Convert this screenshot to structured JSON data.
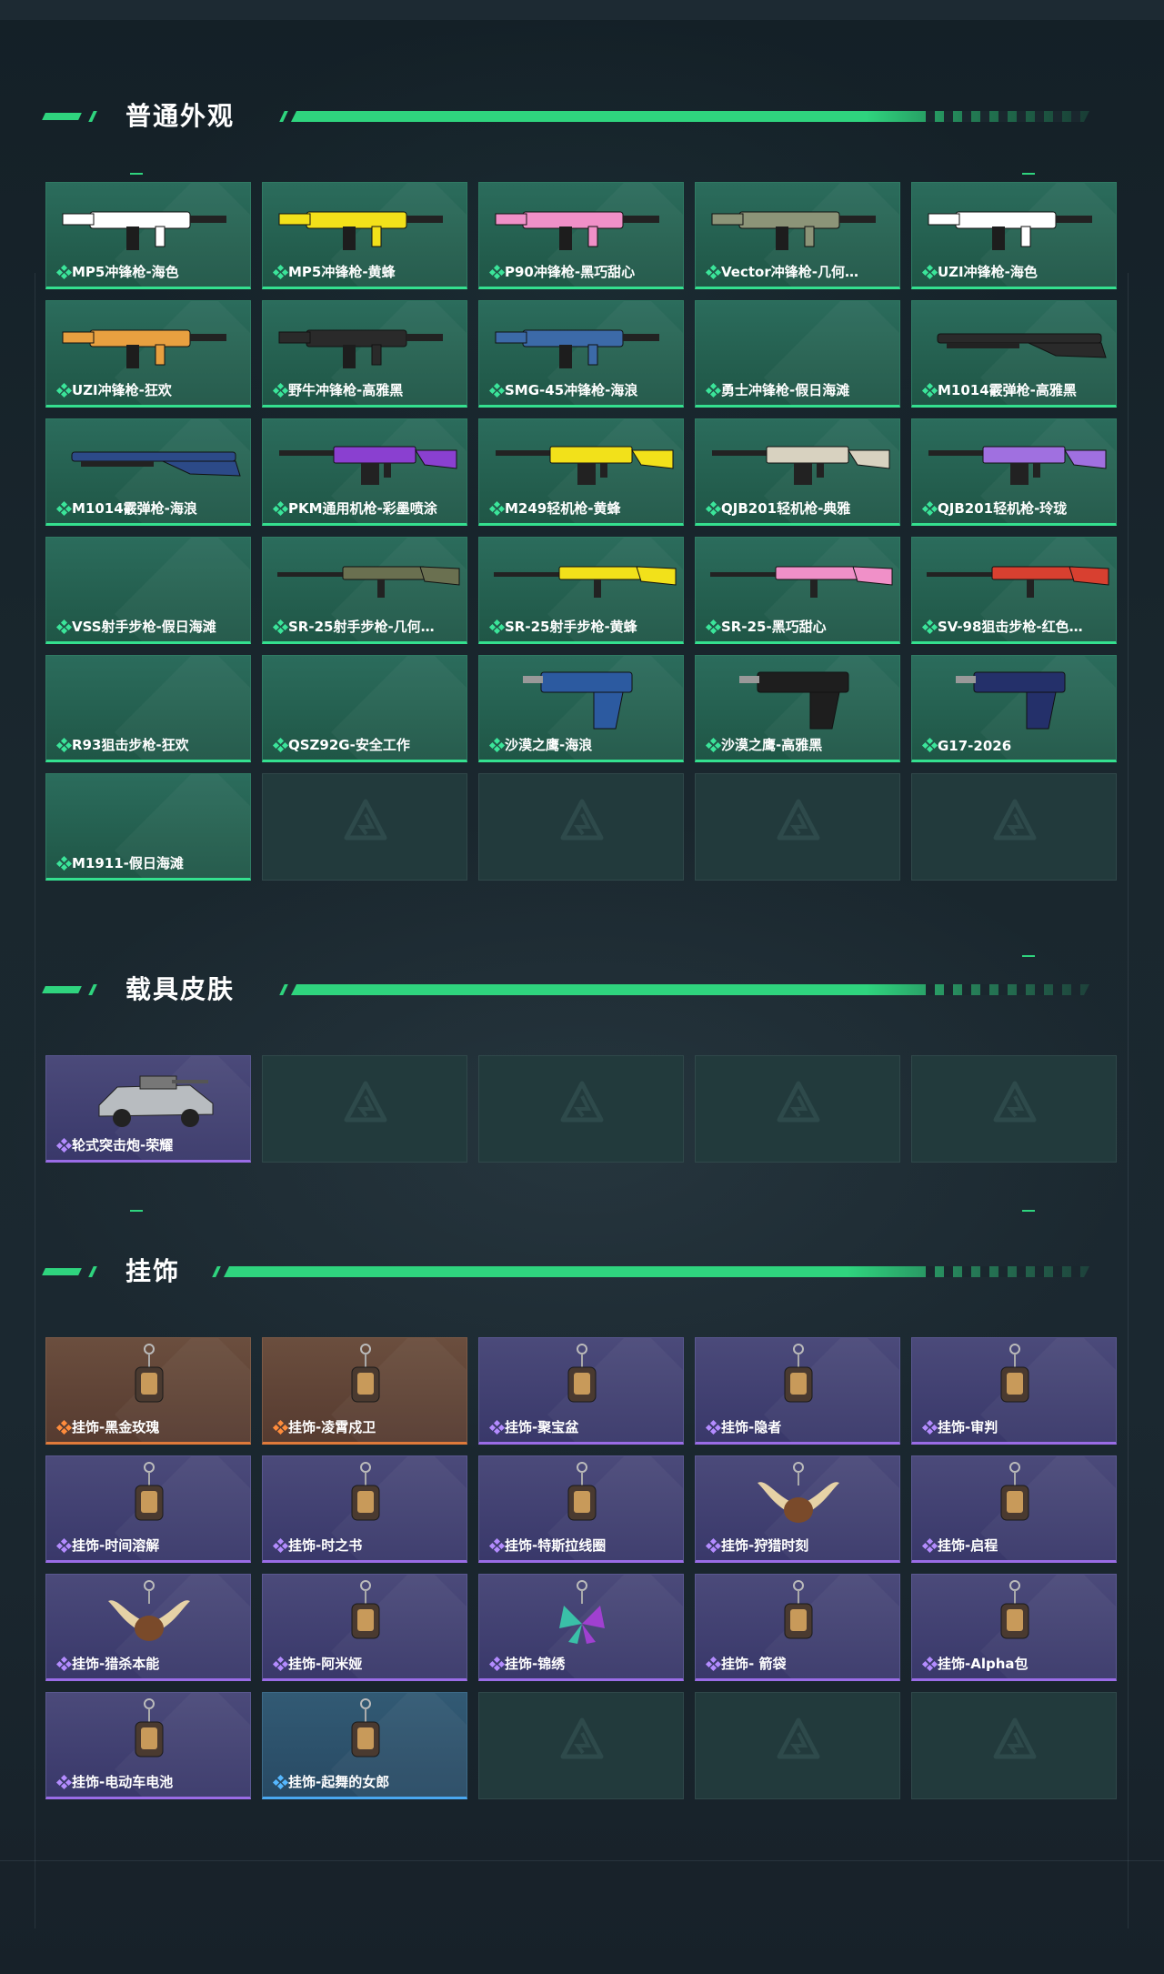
{
  "sections": {
    "weapons": {
      "title": "普通外观"
    },
    "vehicles": {
      "title": "载具皮肤"
    },
    "charms": {
      "title": "挂饰"
    }
  },
  "weapons": [
    {
      "label": "MP5冲锋枪-海色",
      "icon": "smg-icon",
      "color": "#ffffff"
    },
    {
      "label": "MP5冲锋枪-黄蜂",
      "icon": "smg-icon",
      "color": "#f2e11a"
    },
    {
      "label": "P90冲锋枪-黑巧甜心",
      "icon": "smg-icon",
      "color": "#f090c8"
    },
    {
      "label": "Vector冲锋枪-几何…",
      "icon": "smg-icon",
      "color": "#8c9478"
    },
    {
      "label": "UZI冲锋枪-海色",
      "icon": "smg-icon",
      "color": "#ffffff"
    },
    {
      "label": "UZI冲锋枪-狂欢",
      "icon": "smg-icon",
      "color": "#e8a040"
    },
    {
      "label": "野牛冲锋枪-高雅黑",
      "icon": "smg-icon",
      "color": "#2a2a2a"
    },
    {
      "label": "SMG-45冲锋枪-海浪",
      "icon": "smg-icon",
      "color": "#3c6aa8"
    },
    {
      "label": "勇士冲锋枪-假日海滩",
      "icon": "",
      "color": ""
    },
    {
      "label": "M1014霰弹枪-高雅黑",
      "icon": "shotgun-icon",
      "color": "#2a2a2a"
    },
    {
      "label": "M1014霰弹枪-海浪",
      "icon": "shotgun-icon",
      "color": "#2c4a88"
    },
    {
      "label": "PKM通用机枪-彩墨喷涂",
      "icon": "lmg-icon",
      "color": "#8a40d0"
    },
    {
      "label": "M249轻机枪-黄蜂",
      "icon": "lmg-icon",
      "color": "#f2e11a"
    },
    {
      "label": "QJB201轻机枪-典雅",
      "icon": "lmg-icon",
      "color": "#d8d2c0"
    },
    {
      "label": "QJB201轻机枪-玲珑",
      "icon": "lmg-icon",
      "color": "#a070e0"
    },
    {
      "label": "VSS射手步枪-假日海滩",
      "icon": "",
      "color": ""
    },
    {
      "label": "SR-25射手步枪-几何…",
      "icon": "rifle-icon",
      "color": "#6a7050"
    },
    {
      "label": "SR-25射手步枪-黄蜂",
      "icon": "rifle-icon",
      "color": "#f2e11a"
    },
    {
      "label": "SR-25-黑巧甜心",
      "icon": "rifle-icon",
      "color": "#f090c8"
    },
    {
      "label": "SV-98狙击步枪-红色…",
      "icon": "rifle-icon",
      "color": "#d84030"
    },
    {
      "label": "R93狙击步枪-狂欢",
      "icon": "",
      "color": ""
    },
    {
      "label": "QSZ92G-安全工作",
      "icon": "",
      "color": ""
    },
    {
      "label": "沙漠之鹰-海浪",
      "icon": "pistol-icon",
      "color": "#2c5aa0"
    },
    {
      "label": "沙漠之鹰-高雅黑",
      "icon": "pistol-icon",
      "color": "#1e1e1e"
    },
    {
      "label": "G17-2026",
      "icon": "pistol-icon",
      "color": "#24306a"
    },
    {
      "label": "M1911-假日海滩",
      "icon": "",
      "color": ""
    }
  ],
  "vehicles": [
    {
      "label": "轮式突击炮-荣耀",
      "icon": "vehicle-icon",
      "color": "#b8bcc0"
    }
  ],
  "charms": [
    {
      "label": "挂饰-黑金玫瑰",
      "rarity": "orange",
      "icon": "charm-icon"
    },
    {
      "label": "挂饰-凌霄戍卫",
      "rarity": "orange",
      "icon": "charm-icon"
    },
    {
      "label": "挂饰-聚宝盆",
      "rarity": "purple",
      "icon": "charm-icon"
    },
    {
      "label": "挂饰-隐者",
      "rarity": "purple",
      "icon": "charm-icon"
    },
    {
      "label": "挂饰-审判",
      "rarity": "purple",
      "icon": "charm-icon"
    },
    {
      "label": "挂饰-时间溶解",
      "rarity": "purple",
      "icon": "charm-icon"
    },
    {
      "label": "挂饰-时之书",
      "rarity": "purple",
      "icon": "charm-icon"
    },
    {
      "label": "挂饰-特斯拉线圈",
      "rarity": "purple",
      "icon": "charm-icon"
    },
    {
      "label": "挂饰-狩猎时刻",
      "rarity": "purple",
      "icon": "antler-charm-icon"
    },
    {
      "label": "挂饰-启程",
      "rarity": "purple",
      "icon": "charm-icon"
    },
    {
      "label": "挂饰-猎杀本能",
      "rarity": "purple",
      "icon": "antler-charm-icon"
    },
    {
      "label": "挂饰-阿米娅",
      "rarity": "purple",
      "icon": "charm-icon"
    },
    {
      "label": "挂饰-锦绣",
      "rarity": "purple",
      "icon": "butterfly-charm-icon"
    },
    {
      "label": "挂饰- 箭袋",
      "rarity": "purple",
      "icon": "charm-icon"
    },
    {
      "label": "挂饰-Alpha包",
      "rarity": "purple",
      "icon": "charm-icon"
    },
    {
      "label": "挂饰-电动车电池",
      "rarity": "purple",
      "icon": "charm-icon"
    },
    {
      "label": "挂饰-起舞的女郎",
      "rarity": "blue",
      "icon": "charm-icon"
    }
  ],
  "colors": {
    "accent": "#2fd47e",
    "green_card": "#1f5646",
    "purple_card": "#39386a",
    "orange_card": "#563b30",
    "blue_card": "#284a64",
    "empty_card": "#223a3c"
  }
}
